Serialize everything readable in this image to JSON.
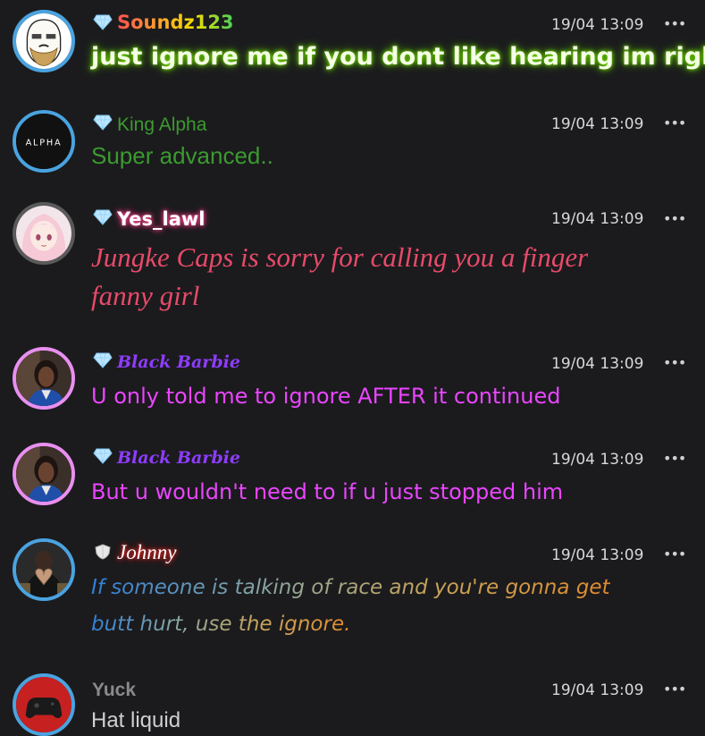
{
  "messages": [
    {
      "username": "Soundz123",
      "time": "19/04 13:09",
      "text_lines": [
        "just ignore me if you dont like hearing im right"
      ],
      "avatar": "cartoon-face-avatar",
      "badge": "diamond-icon",
      "ring_color": "#4aa3e0"
    },
    {
      "username": "King Alpha",
      "time": "19/04 13:09",
      "text_lines": [
        "Super advanced.."
      ],
      "avatar_text": "ALPHA",
      "badge": "diamond-icon",
      "ring_color": "#4aa3e0"
    },
    {
      "username": "Yes_lawl",
      "time": "19/04 13:09",
      "text_lines": [
        "Jungke Caps is sorry for calling you a finger",
        "fanny girl"
      ],
      "avatar": "anime-girl-avatar",
      "badge": "diamond-icon",
      "ring_color": "#5a5a5a"
    },
    {
      "username": "Black Barbie",
      "time": "19/04 13:09",
      "text_lines": [
        "U only told me to ignore AFTER it continued"
      ],
      "avatar": "woman-portrait-avatar",
      "badge": "diamond-icon",
      "ring_color": "#e98ff0"
    },
    {
      "username": "Black Barbie",
      "time": "19/04 13:09",
      "text_lines": [
        "But u wouldn't need to if u just stopped him"
      ],
      "avatar": "woman-portrait-avatar",
      "badge": "diamond-icon",
      "ring_color": "#e98ff0"
    },
    {
      "username": "Johnny",
      "time": "19/04 13:09",
      "text_lines": [
        "If someone is talking of race and you're gonna get",
        "butt hurt, use the ignore."
      ],
      "avatar": "man-heart-hands-avatar",
      "badge": "shield-icon",
      "ring_color": "#4aa3e0"
    },
    {
      "username": "Yuck",
      "time": "19/04 13:09",
      "text_lines": [
        "Hat liquid"
      ],
      "avatar": "game-controller-avatar",
      "ring_color": "#4aa3e0"
    }
  ],
  "more_icon": "ellipsis-icon",
  "more_glyph": "•••"
}
